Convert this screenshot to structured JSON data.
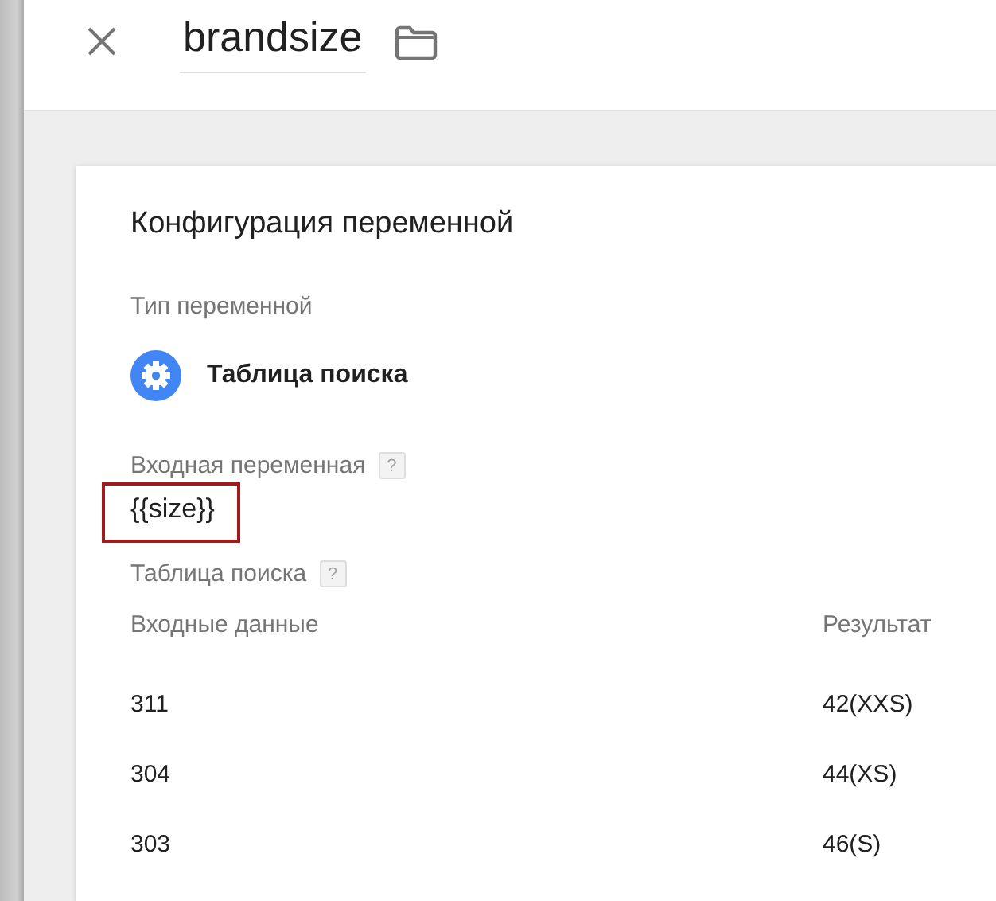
{
  "header": {
    "title": "brandsize"
  },
  "card": {
    "title": "Конфигурация переменной",
    "variable_type": {
      "label": "Тип переменной",
      "value": "Таблица поиска"
    },
    "input_variable": {
      "label": "Входная переменная",
      "help": "?",
      "value": "{{size}}",
      "highlighted": true
    },
    "lookup_table": {
      "label": "Таблица поиска",
      "help": "?",
      "columns": [
        "Входные данные",
        "Результат"
      ],
      "rows": [
        {
          "input": "311",
          "result": "42(XXS)"
        },
        {
          "input": "304",
          "result": "44(XS)"
        },
        {
          "input": "303",
          "result": "46(S)"
        }
      ]
    }
  }
}
